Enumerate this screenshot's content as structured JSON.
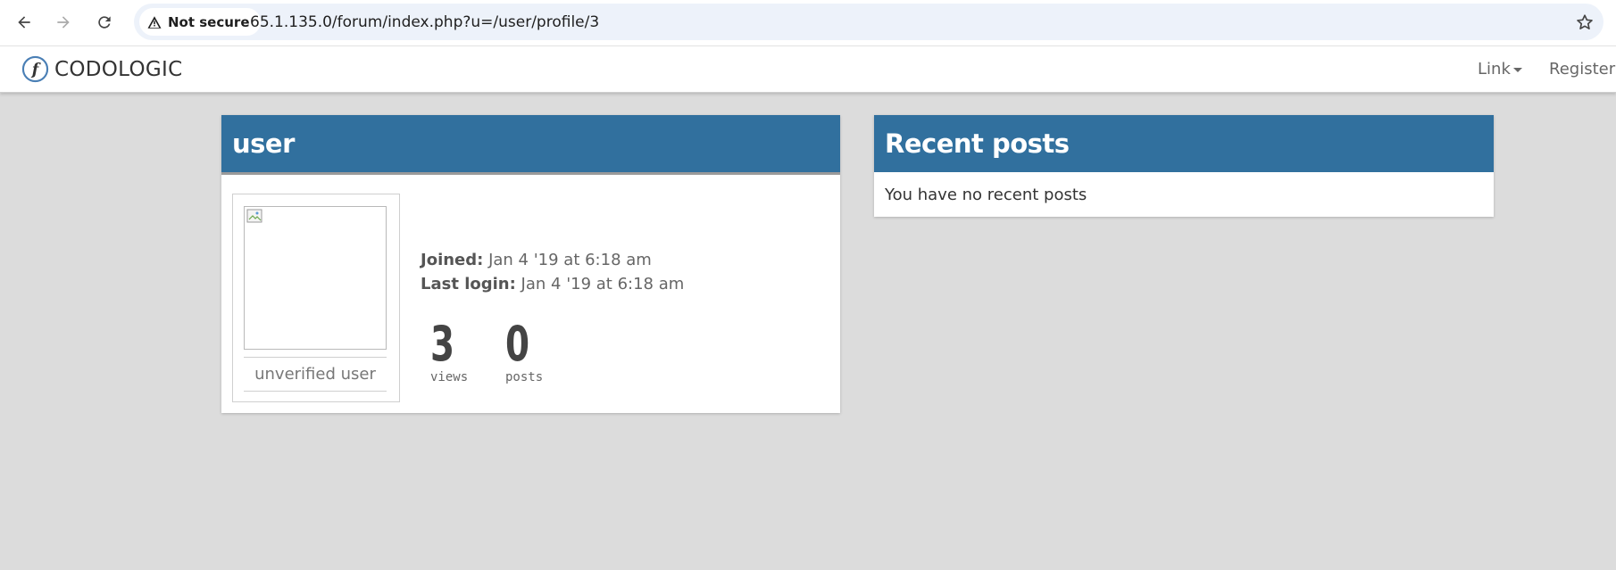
{
  "browser": {
    "security_label": "Not secure",
    "url": "65.1.135.0/forum/index.php?u=/user/profile/3",
    "icons": [
      "back-arrow-icon",
      "forward-arrow-icon",
      "reload-icon",
      "warning-icon",
      "bookmark-star-icon"
    ]
  },
  "navbar": {
    "brand": "CODOLOGIC",
    "links": [
      {
        "label": "Link"
      },
      {
        "label": "Register"
      }
    ]
  },
  "profile": {
    "username": "user",
    "rank": "unverified user",
    "joined_label": "Joined:",
    "joined_value": "Jan 4 '19 at 6:18 am",
    "last_login_label": "Last login:",
    "last_login_value": "Jan 4 '19 at 6:18 am",
    "stats": [
      {
        "value": "3",
        "label": "views"
      },
      {
        "value": "0",
        "label": "posts"
      }
    ]
  },
  "recent_posts": {
    "title": "Recent posts",
    "empty_message": "You have no recent posts"
  },
  "colors": {
    "panel_header": "#31709e",
    "page_background": "#dcdcdc"
  }
}
